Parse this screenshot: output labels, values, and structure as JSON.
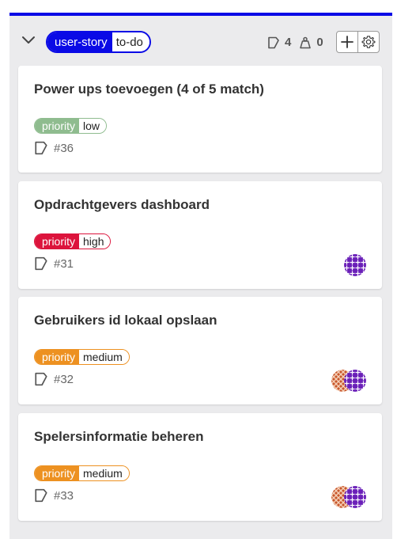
{
  "list": {
    "label_scope": "user-story",
    "label_value": "to-do",
    "issue_count": "4",
    "weight_count": "0",
    "accent_color": "#0a0ae6"
  },
  "cards": [
    {
      "title": "Power ups toevoegen (4 of 5 match)",
      "priority_scope": "priority",
      "priority_value": "low",
      "priority_color": "#8fbc8f",
      "reference": "#36",
      "assignees": []
    },
    {
      "title": "Opdrachtgevers dashboard",
      "priority_scope": "priority",
      "priority_value": "high",
      "priority_color": "#dc143c",
      "reference": "#31",
      "assignees": [
        "purple-pattern-avatar"
      ]
    },
    {
      "title": "Gebruikers id lokaal opslaan",
      "priority_scope": "priority",
      "priority_value": "medium",
      "priority_color": "#ed9121",
      "reference": "#32",
      "assignees": [
        "orange-pattern-avatar",
        "purple-pattern-avatar"
      ]
    },
    {
      "title": "Spelersinformatie beheren",
      "priority_scope": "priority",
      "priority_value": "medium",
      "priority_color": "#ed9121",
      "reference": "#33",
      "assignees": [
        "orange-pattern-avatar",
        "purple-pattern-avatar"
      ]
    }
  ]
}
